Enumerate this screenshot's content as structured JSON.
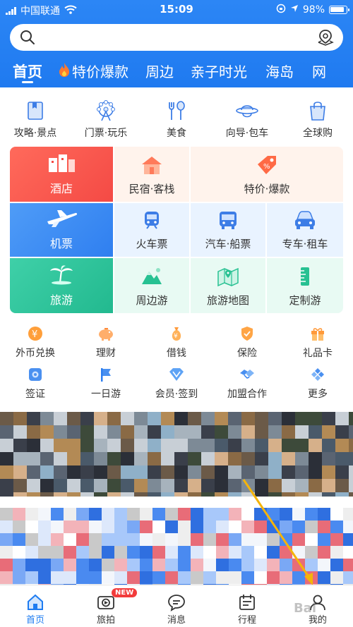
{
  "status_bar": {
    "carrier": "中国联通",
    "time": "15:09",
    "battery": "98%"
  },
  "search": {
    "placeholder": ""
  },
  "tabs": [
    {
      "label": "首页"
    },
    {
      "label": "特价爆款"
    },
    {
      "label": "周边"
    },
    {
      "label": "亲子时光"
    },
    {
      "label": "海岛"
    },
    {
      "label": "网"
    }
  ],
  "top_icons": [
    {
      "label": "攻略·景点",
      "icon": "book-icon"
    },
    {
      "label": "门票·玩乐",
      "icon": "ferris-wheel-icon"
    },
    {
      "label": "美食",
      "icon": "fork-spoon-icon"
    },
    {
      "label": "向导·包车",
      "icon": "guide-hat-icon"
    },
    {
      "label": "全球购",
      "icon": "shopping-bag-icon"
    }
  ],
  "grid": {
    "hotel": "酒店",
    "homestay": "民宿·客栈",
    "special": "特价·爆款",
    "flight": "机票",
    "train": "火车票",
    "bus": "汽车·船票",
    "car": "专车·租车",
    "travel": "旅游",
    "nearby": "周边游",
    "map": "旅游地图",
    "custom": "定制游"
  },
  "small_row1": [
    {
      "label": "外币兑换",
      "icon": "yen-icon"
    },
    {
      "label": "理财",
      "icon": "piggy-bank-icon"
    },
    {
      "label": "借钱",
      "icon": "money-bag-icon"
    },
    {
      "label": "保险",
      "icon": "shield-icon"
    },
    {
      "label": "礼品卡",
      "icon": "gift-icon"
    }
  ],
  "small_row2": [
    {
      "label": "签证",
      "icon": "visa-icon"
    },
    {
      "label": "一日游",
      "icon": "flag-icon"
    },
    {
      "label": "会员·签到",
      "icon": "diamond-icon"
    },
    {
      "label": "加盟合作",
      "icon": "handshake-icon"
    },
    {
      "label": "更多",
      "icon": "more-icon"
    }
  ],
  "bottom_nav": [
    {
      "label": "首页",
      "icon": "home-icon",
      "active": true
    },
    {
      "label": "旅拍",
      "icon": "camera-icon",
      "badge": "NEW"
    },
    {
      "label": "消息",
      "icon": "message-icon"
    },
    {
      "label": "行程",
      "icon": "itinerary-icon"
    },
    {
      "label": "我的",
      "icon": "profile-icon"
    }
  ],
  "watermark": "Bai"
}
